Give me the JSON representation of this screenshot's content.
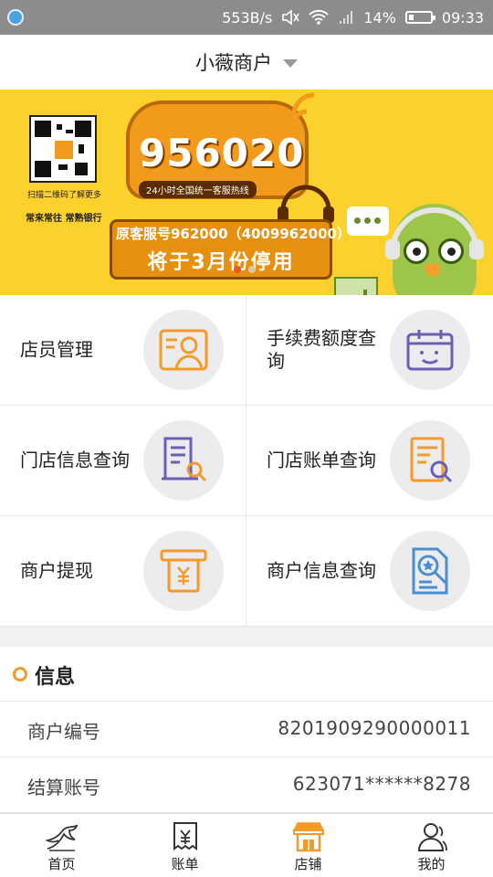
{
  "status_bar": {
    "speed": "553B/s",
    "battery": "14%",
    "time": "09:33"
  },
  "header": {
    "title": "小薇商户"
  },
  "banner": {
    "qr_caption": "扫描二维码了解更多",
    "bank": "常来常往 常熟银行",
    "hotline": "956020",
    "hotline_sub": "24小时全国统一客服热线",
    "old_line": "原客服号962000（4009962000）",
    "notice": "将于3月份停用",
    "active_dot": 0,
    "dot_count": 2
  },
  "grid": {
    "items": [
      {
        "label": "店员管理",
        "icon": "staff-management-icon"
      },
      {
        "label": "手续费额度查询",
        "icon": "fee-quota-icon"
      },
      {
        "label": "门店信息查询",
        "icon": "store-info-icon"
      },
      {
        "label": "门店账单查询",
        "icon": "store-bill-icon"
      },
      {
        "label": "商户提现",
        "icon": "withdraw-icon"
      },
      {
        "label": "商户信息查询",
        "icon": "merchant-info-icon"
      }
    ]
  },
  "info": {
    "title": "信息",
    "rows": [
      {
        "key": "商户编号",
        "value": "8201909290000011"
      },
      {
        "key": "结算账号",
        "value": "623071******8278"
      }
    ]
  },
  "tabbar": {
    "tabs": [
      {
        "label": "首页",
        "icon": "home-icon"
      },
      {
        "label": "账单",
        "icon": "bill-icon"
      },
      {
        "label": "店铺",
        "icon": "shop-icon"
      },
      {
        "label": "我的",
        "icon": "profile-icon"
      }
    ],
    "active": "店铺"
  },
  "colors": {
    "accent_orange": "#f39a2b",
    "icon_purple": "#6b5fb5",
    "banner_yellow": "#fdd12d"
  }
}
